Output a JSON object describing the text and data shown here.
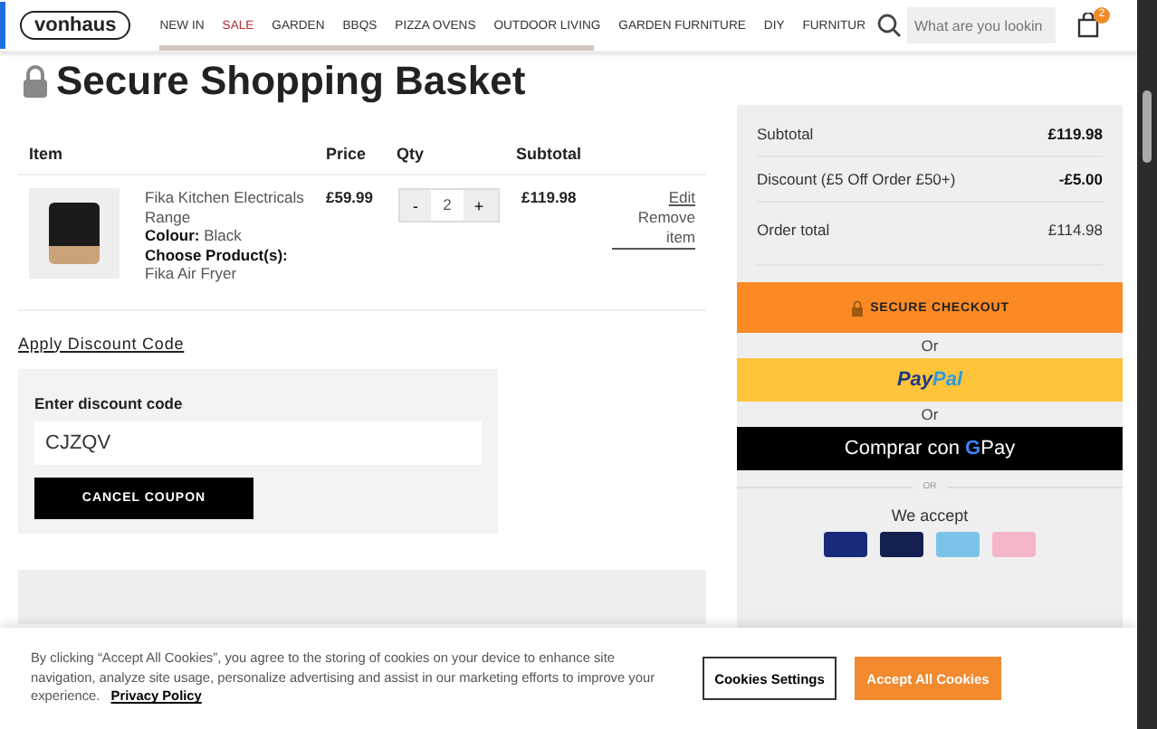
{
  "header": {
    "logo": "vonhaus",
    "nav": [
      {
        "label": "NEW IN",
        "highlighted": false
      },
      {
        "label": "SALE",
        "highlighted": true
      },
      {
        "label": "GARDEN",
        "highlighted": false
      },
      {
        "label": "BBQS",
        "highlighted": false
      },
      {
        "label": "PIZZA OVENS",
        "highlighted": false
      },
      {
        "label": "OUTDOOR LIVING",
        "highlighted": false
      },
      {
        "label": "GARDEN FURNITURE",
        "highlighted": false
      },
      {
        "label": "DIY",
        "highlighted": false
      },
      {
        "label": "FURNITUR",
        "highlighted": false
      }
    ],
    "search": {
      "placeholder": "What are you lookin"
    },
    "cart_count": "2"
  },
  "title": "Secure Shopping Basket",
  "basket": {
    "columns": [
      "Item",
      "Price",
      "Qty",
      "Subtotal"
    ],
    "items": [
      {
        "name": "Fika Kitchen Electricals Range",
        "colour_label": "Colour:",
        "colour": "Black",
        "product_label": "Choose Product(s):",
        "product": "Fika Air Fryer",
        "price": "£59.99",
        "qty": "2",
        "minus": "-",
        "plus": "+",
        "subtotal": "£119.98",
        "edit": "Edit",
        "remove": "Remove item"
      }
    ]
  },
  "discount": {
    "toggle": "Apply Discount Code",
    "label": "Enter discount code",
    "value": "CJZQV",
    "button": "CANCEL COUPON"
  },
  "summary": {
    "rows": [
      {
        "label": "Subtotal",
        "value": "£119.98",
        "bold": true
      },
      {
        "label": "Discount (£5 Off Order £50+)",
        "value": "-£5.00",
        "bold": true
      },
      {
        "label": "Order total",
        "value": "£114.98",
        "bold": false
      }
    ],
    "checkout": "SECURE CHECKOUT",
    "or_1": "Or",
    "paypal_1": "Pay",
    "paypal_2": "Pal",
    "or_2": "Or",
    "gpay_text": "Comprar con",
    "gpay_g": "G",
    "gpay_pay": "Pay",
    "or_3": "OR",
    "accept": "We accept"
  },
  "cookie": {
    "text": "By clicking “Accept All Cookies”, you agree to the storing of cookies on your device to enhance site navigation, analyze site usage, personalize advertising and assist in our marketing efforts to improve your experience.",
    "link": "Privacy Policy",
    "settings": "Cookies Settings",
    "accept": "Accept All Cookies"
  }
}
